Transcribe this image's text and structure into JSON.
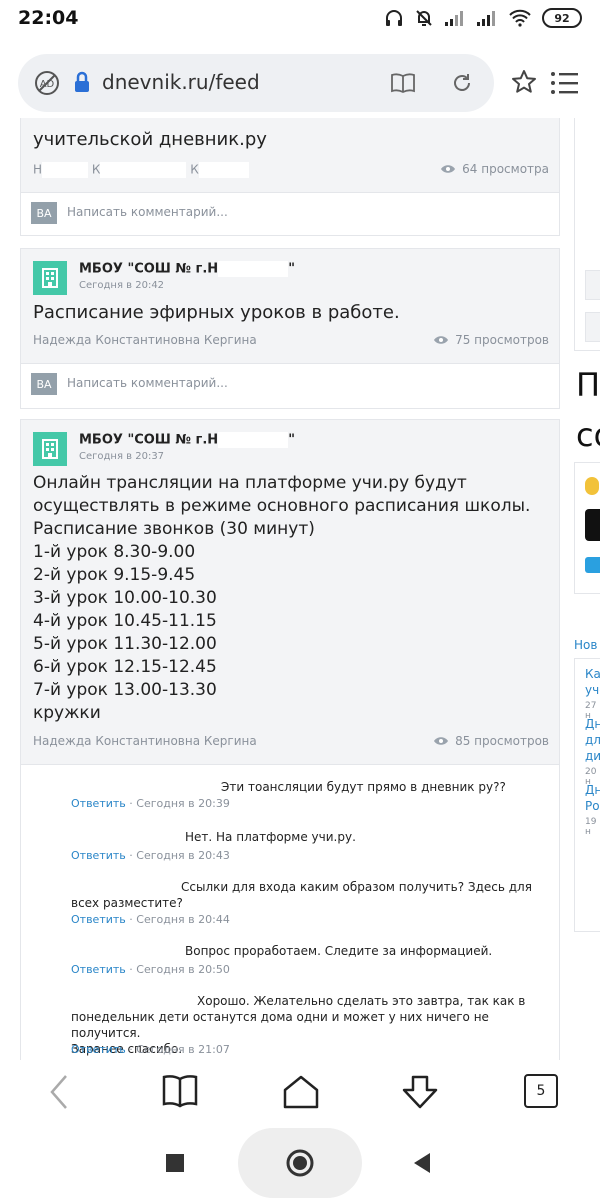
{
  "status": {
    "time": "22:04",
    "battery": "92"
  },
  "browser": {
    "url": "dnevnik.ru/feed",
    "icons": [
      "adblock-icon",
      "lock-icon",
      "reader-mode-icon",
      "reload-icon",
      "star-icon",
      "menu-icon"
    ]
  },
  "posts": [
    {
      "text": "учительской дневник.ру",
      "author_parts": [
        "Н",
        "К",
        "К"
      ],
      "views": "64 просмотра",
      "comment_placeholder": "Написать комментарий...",
      "avatar": "ВА"
    },
    {
      "org": "МБОУ \"СОШ №   г.Н",
      "org_suffix": "\"",
      "time": "Сегодня в 20:42",
      "text": "Расписание эфирных уроков в работе.",
      "author": "Надежда Константиновна Кергина",
      "views": "75 просмотров",
      "comment_placeholder": "Написать комментарий...",
      "avatar": "ВА"
    },
    {
      "org": "МБОУ \"СОШ №   г.Н",
      "org_suffix": "\"",
      "time": "Сегодня в 20:37",
      "text_lines": [
        "Онлайн трансляции на платформе учи.ру будут",
        "осуществлять в режиме основного расписания школы.",
        "Расписание звонков (30 минут)",
        "1-й урок 8.30-9.00",
        "2-й урок 9.15-9.45",
        "3-й урок 10.00-10.30",
        "4-й урок 10.45-11.15",
        "5-й урок 11.30-12.00",
        "6-й урок 12.15-12.45",
        "7-й урок 13.00-13.30",
        "кружки"
      ],
      "author": "Надежда Константиновна Кергина",
      "views": "85 просмотров"
    }
  ],
  "comments": [
    {
      "lines": [
        "Эти тоансляции будут прямо в дневник ру??"
      ],
      "reply": "Ответить",
      "time": "Сегодня в 20:39"
    },
    {
      "lines": [
        "Нет. На платформе учи.ру."
      ],
      "reply": "Ответить",
      "time": "Сегодня в 20:43"
    },
    {
      "lines": [
        "Ссылки для входа каким образом получить? Здесь для",
        "всех разместите?"
      ],
      "reply": "Ответить",
      "time": "Сегодня в 20:44"
    },
    {
      "lines": [
        "Вопрос проработаем. Следите за информацией."
      ],
      "reply": "Ответить",
      "time": "Сегодня в 20:50"
    },
    {
      "lines": [
        "Хорошо. Желательно сделать это завтра, так как в",
        "понедельник дети останутся дома одни и может у них ничего не получится.",
        "Заранее спасибо."
      ],
      "reply": "Ответить",
      "time": "Сегодня в 21:07"
    }
  ],
  "sidebar_fragments": {
    "big1": "П",
    "big2": "со",
    "news_label": "Нов",
    "items": [
      "Ка",
      "уче",
      "27 н",
      "Дн",
      "для",
      "дис",
      "20 н",
      "Дн",
      "Ро",
      "19 н"
    ]
  },
  "nav": {
    "tabs_count": "5"
  },
  "colors": {
    "link": "#2a86c8",
    "org_icon": "#44c8a8",
    "avatar": "#93a0aa",
    "muted": "#8a919b"
  }
}
